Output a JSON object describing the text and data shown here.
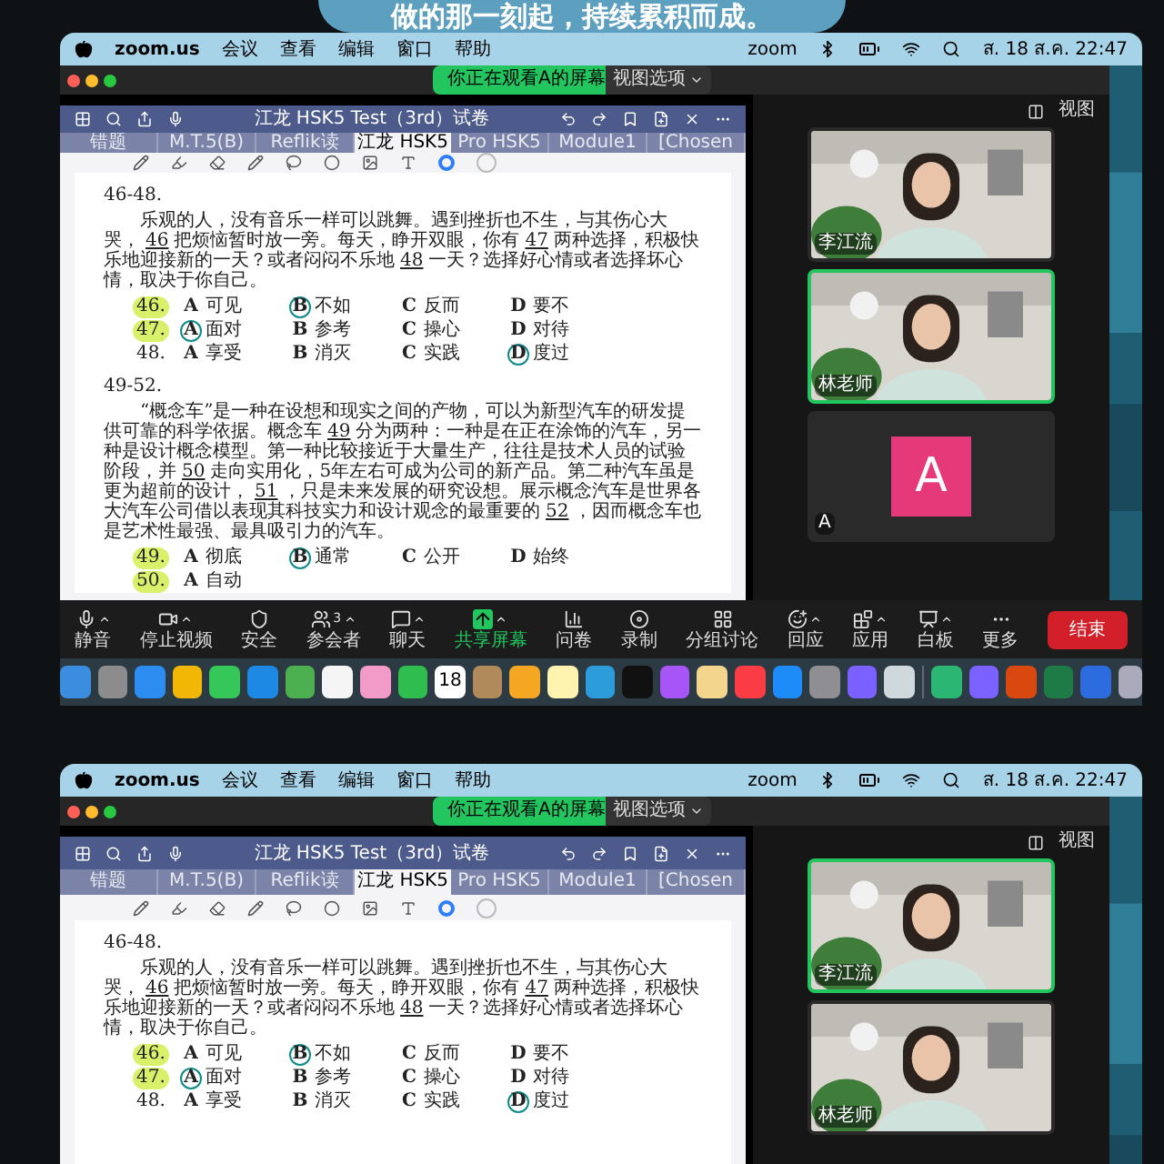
{
  "banner": {
    "text": "做的那一刻起，持续累积而成。"
  },
  "screens": [
    {
      "menu_bar": {
        "app": "zoom.us",
        "items": [
          "会议",
          "查看",
          "编辑",
          "窗口",
          "帮助"
        ],
        "brand": "zoom",
        "clock": "ส. 18 ส.ค.  22:47"
      },
      "share_banner": {
        "text": "你正在观看A的屏幕",
        "options": "视图选项"
      },
      "view_button": "视图",
      "ipad": {
        "title": "江龙 HSK5 Test（3rd）试卷",
        "tabs": [
          {
            "label": "错题",
            "selected": false
          },
          {
            "label": "M.T.5(B)",
            "selected": false
          },
          {
            "label": "Reflik读",
            "selected": false
          },
          {
            "label": "江龙 HSK5",
            "selected": true
          },
          {
            "label": "Pro HSK5",
            "selected": false
          },
          {
            "label": "Module1",
            "selected": false
          },
          {
            "label": "[Chosen",
            "selected": false
          }
        ]
      },
      "document": {
        "sections": [
          {
            "heading": "46-48.",
            "paragraph": [
              {
                "kind": "plain",
                "text": "乐观的人，没有音乐一样可以跳舞。遇到挫折也不生，与其伤心大哭，"
              },
              {
                "kind": "blank",
                "text": "46"
              },
              {
                "kind": "plain",
                "text": "把烦恼暂时放一旁。每天，睁开双眼，你有"
              },
              {
                "kind": "blank",
                "text": "47"
              },
              {
                "kind": "plain",
                "text": "两种选择，积极快乐地迎接新的一天？或者闷闷不乐地"
              },
              {
                "kind": "blank",
                "text": "48"
              },
              {
                "kind": "plain",
                "text": "一天？选择好心情或者选择坏心情，取决于你自己。"
              }
            ],
            "questions": [
              {
                "number": "46.",
                "highlighted": true,
                "options": [
                  {
                    "letter": "A",
                    "text": "可见",
                    "selected": false
                  },
                  {
                    "letter": "B",
                    "text": "不如",
                    "selected": true
                  },
                  {
                    "letter": "C",
                    "text": "反而",
                    "selected": false
                  },
                  {
                    "letter": "D",
                    "text": "要不",
                    "selected": false
                  }
                ]
              },
              {
                "number": "47.",
                "highlighted": true,
                "options": [
                  {
                    "letter": "A",
                    "text": "面对",
                    "selected": true
                  },
                  {
                    "letter": "B",
                    "text": "参考",
                    "selected": false
                  },
                  {
                    "letter": "C",
                    "text": "操心",
                    "selected": false
                  },
                  {
                    "letter": "D",
                    "text": "对待",
                    "selected": false
                  }
                ]
              },
              {
                "number": "48.",
                "highlighted": false,
                "options": [
                  {
                    "letter": "A",
                    "text": "享受",
                    "selected": false
                  },
                  {
                    "letter": "B",
                    "text": "消灭",
                    "selected": false
                  },
                  {
                    "letter": "C",
                    "text": "实践",
                    "selected": false
                  },
                  {
                    "letter": "D",
                    "text": "度过",
                    "selected": true
                  }
                ]
              }
            ]
          },
          {
            "heading": "49-52.",
            "paragraph": [
              {
                "kind": "plain",
                "text": "“概念车”是一种在设想和现实之间的产物，可以为新型汽车的研发提供可靠的科学依据。概念车"
              },
              {
                "kind": "blank",
                "text": "49"
              },
              {
                "kind": "plain",
                "text": "分为两种：一种是在正在涂饰的汽车，另一种是设计概念模型。第一种比较接近于大量生产，往往是技术人员的试验阶段，并"
              },
              {
                "kind": "blank",
                "text": "50"
              },
              {
                "kind": "plain",
                "text": "走向实用化，5年左右可成为公司的新产品。第二种汽车虽是更为超前的设计，"
              },
              {
                "kind": "blank",
                "text": "51"
              },
              {
                "kind": "plain",
                "text": "，只是未来发展的研究设想。展示概念汽车是世界各大汽车公司借以表现其科技实力和设计观念的最重要的"
              },
              {
                "kind": "blank",
                "text": "52"
              },
              {
                "kind": "plain",
                "text": "，因而概念车也是艺术性最强、最具吸引力的汽车。"
              }
            ],
            "questions": [
              {
                "number": "49.",
                "highlighted": true,
                "options": [
                  {
                    "letter": "A",
                    "text": "彻底",
                    "selected": false
                  },
                  {
                    "letter": "B",
                    "text": "通常",
                    "selected": true
                  },
                  {
                    "letter": "C",
                    "text": "公开",
                    "selected": false
                  },
                  {
                    "letter": "D",
                    "text": "始终",
                    "selected": false
                  }
                ]
              },
              {
                "number": "50.",
                "highlighted": true,
                "options": [
                  {
                    "letter": "A",
                    "text": "自动",
                    "selected": false
                  }
                ]
              }
            ]
          }
        ]
      },
      "videos": [
        {
          "kind": "camera",
          "name": "李江流",
          "active": false
        },
        {
          "kind": "camera",
          "name": "林老师",
          "active": true
        },
        {
          "kind": "avatar",
          "initial": "A",
          "name": "A",
          "active": false
        }
      ],
      "toolbar": [
        {
          "kind": "mic",
          "label": "静音",
          "caret": true
        },
        {
          "kind": "video",
          "label": "停止视频",
          "caret": true
        },
        {
          "kind": "shield",
          "label": "安全",
          "caret": false
        },
        {
          "kind": "users",
          "label": "参会者",
          "count": "3",
          "caret": true
        },
        {
          "kind": "chat",
          "label": "聊天",
          "caret": true
        },
        {
          "kind": "share",
          "label": "共享屏幕",
          "caret": true,
          "selected": true
        },
        {
          "kind": "poll",
          "label": "问卷",
          "caret": false
        },
        {
          "kind": "record",
          "label": "录制",
          "caret": false
        },
        {
          "kind": "rooms",
          "label": "分组讨论",
          "caret": false
        },
        {
          "kind": "react",
          "label": "回应",
          "caret": true
        },
        {
          "kind": "apps",
          "label": "应用",
          "caret": true
        },
        {
          "kind": "whiteboard",
          "label": "白板",
          "caret": true
        },
        {
          "kind": "more",
          "label": "更多",
          "caret": false
        }
      ],
      "end_button": "结束",
      "dock": {
        "calendar_day": "18"
      }
    },
    {
      "menu_bar": {
        "app": "zoom.us",
        "items": [
          "会议",
          "查看",
          "编辑",
          "窗口",
          "帮助"
        ],
        "brand": "zoom",
        "clock": "ส. 18 ส.ค.  22:47"
      },
      "share_banner": {
        "text": "你正在观看A的屏幕",
        "options": "视图选项"
      },
      "view_button": "视图",
      "ipad": {
        "title": "江龙 HSK5 Test（3rd）试卷",
        "tabs": [
          {
            "label": "错题",
            "selected": false
          },
          {
            "label": "M.T.5(B)",
            "selected": false
          },
          {
            "label": "Reflik读",
            "selected": false
          },
          {
            "label": "江龙 HSK5",
            "selected": true
          },
          {
            "label": "Pro HSK5",
            "selected": false
          },
          {
            "label": "Module1",
            "selected": false
          },
          {
            "label": "[Chosen",
            "selected": false
          }
        ]
      },
      "document": {
        "sections": [
          {
            "heading": "46-48.",
            "paragraph": [
              {
                "kind": "plain",
                "text": "乐观的人，没有音乐一样可以跳舞。遇到挫折也不生，与其伤心大哭，"
              },
              {
                "kind": "blank",
                "text": "46"
              },
              {
                "kind": "plain",
                "text": "把烦恼暂时放一旁。每天，睁开双眼，你有"
              },
              {
                "kind": "blank",
                "text": "47"
              },
              {
                "kind": "plain",
                "text": "两种选择，积极快乐地迎接新的一天？或者闷闷不乐地"
              },
              {
                "kind": "blank",
                "text": "48"
              },
              {
                "kind": "plain",
                "text": "一天？选择好心情或者选择坏心情，取决于你自己。"
              }
            ],
            "questions": [
              {
                "number": "46.",
                "highlighted": true,
                "options": [
                  {
                    "letter": "A",
                    "text": "可见",
                    "selected": false
                  },
                  {
                    "letter": "B",
                    "text": "不如",
                    "selected": true
                  },
                  {
                    "letter": "C",
                    "text": "反而",
                    "selected": false
                  },
                  {
                    "letter": "D",
                    "text": "要不",
                    "selected": false
                  }
                ]
              },
              {
                "number": "47.",
                "highlighted": true,
                "options": [
                  {
                    "letter": "A",
                    "text": "面对",
                    "selected": true
                  },
                  {
                    "letter": "B",
                    "text": "参考",
                    "selected": false
                  },
                  {
                    "letter": "C",
                    "text": "操心",
                    "selected": false
                  },
                  {
                    "letter": "D",
                    "text": "对待",
                    "selected": false
                  }
                ]
              },
              {
                "number": "48.",
                "highlighted": false,
                "options": [
                  {
                    "letter": "A",
                    "text": "享受",
                    "selected": false
                  },
                  {
                    "letter": "B",
                    "text": "消灭",
                    "selected": false
                  },
                  {
                    "letter": "C",
                    "text": "实践",
                    "selected": false
                  },
                  {
                    "letter": "D",
                    "text": "度过",
                    "selected": true
                  }
                ]
              }
            ]
          }
        ]
      },
      "videos": [
        {
          "kind": "camera",
          "name": "李江流",
          "active": true
        },
        {
          "kind": "camera",
          "name": "林老师",
          "active": false
        }
      ]
    }
  ]
}
